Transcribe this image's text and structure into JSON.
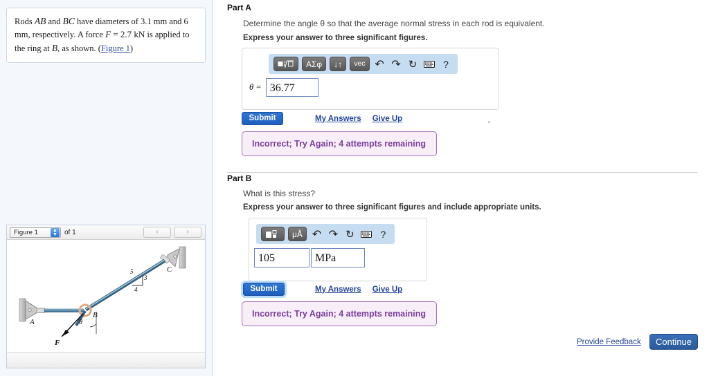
{
  "problem": {
    "line1_a": "Rods ",
    "rod_ab": "AB",
    "line1_b": " and ",
    "rod_bc": "BC",
    "line1_c": " have diameters of 3.1 mm and",
    "line2_a": "6 mm, respectively. A force ",
    "force_eq": "F = 2.7 kN",
    "line2_b": " is applied to",
    "line3_a": "the ring at ",
    "point_b": "B",
    "line3_b": ", as shown. (",
    "figure_link": "Figure 1",
    "line3_c": ")"
  },
  "figure": {
    "select_value": "Figure 1",
    "of_label": "of 1",
    "prev_label": "‹",
    "next_label": "›",
    "labels": {
      "a": "A",
      "b": "B",
      "c": "C",
      "f": "F",
      "theta": "θ",
      "tri_hyp": "5",
      "tri_vert": "3",
      "tri_horiz": "4"
    }
  },
  "partA": {
    "header": "Part A",
    "question": "Determine the angle θ so that the average normal stress in each rod is equivalent.",
    "instruction": "Express your answer to three significant figures.",
    "toolbar": {
      "template_label": "■√□",
      "greek_label": "ΑΣφ",
      "arrows_label": "↓↑",
      "vec_label": "vec",
      "undo_label": "↶",
      "redo_label": "↷",
      "reset_label": "↻",
      "keyboard_label": "⌨",
      "help_label": "?"
    },
    "eq_label": "θ =",
    "answer_value": "36.77",
    "unit_mark": "°",
    "submit_label": "Submit",
    "my_answers_label": "My Answers",
    "give_up_label": "Give Up",
    "feedback": "Incorrect; Try Again; 4 attempts remaining"
  },
  "partB": {
    "header": "Part B",
    "question": "What is this stress?",
    "instruction": "Express your answer to three significant figures and include appropriate units.",
    "toolbar": {
      "template_label": "■□",
      "units_label": "μÅ",
      "undo_label": "↶",
      "redo_label": "↷",
      "reset_label": "↻",
      "keyboard_label": "⌨",
      "help_label": "?"
    },
    "answer_value": "105",
    "answer_units": "MPa",
    "submit_label": "Submit",
    "my_answers_label": "My Answers",
    "give_up_label": "Give Up",
    "feedback": "Incorrect; Try Again; 4 attempts remaining"
  },
  "footer": {
    "provide_feedback_label": "Provide Feedback",
    "continue_label": "Continue"
  },
  "colors": {
    "accent_blue": "#2f76d4",
    "link_blue": "#23449b",
    "toolbar_blue": "#c6dcf1",
    "feedback_purple": "#7b3f9d",
    "feedback_bg": "#f7eef8",
    "left_panel_bg": "#f4f7fc"
  }
}
